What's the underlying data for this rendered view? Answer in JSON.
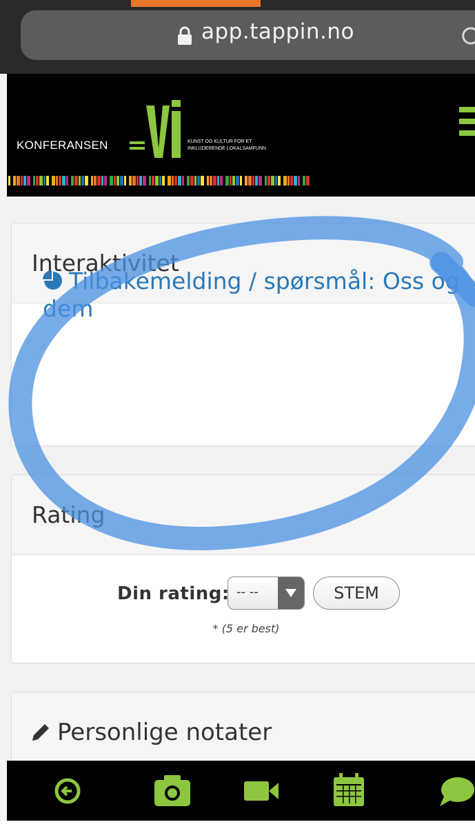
{
  "browser": {
    "url": "app.tappin.no"
  },
  "header": {
    "logo": {
      "left_text": "KONFERANSEN",
      "big_text": "Vi",
      "tagline_line1": "KUNST OG KULTUR FOR ET",
      "tagline_line2": "INKLUDERENDE LOKALSAMFUNN"
    },
    "menu_icon": "hamburger-icon",
    "accent_color": "#8dc63f"
  },
  "sections": {
    "interaktivitet": {
      "title": "Interaktivitet",
      "link_icon": "pie-chart-icon",
      "link_text": "Tilbakemelding / spørsmål: Oss og dem"
    },
    "rating": {
      "title": "Rating",
      "label": "Din rating:",
      "select_value": "-- --",
      "submit_label": "STEM",
      "note": "* (5 er best)"
    },
    "notes": {
      "title": "Personlige notater",
      "icon": "pencil-icon"
    }
  },
  "bottom_nav": {
    "items": [
      {
        "icon": "back-arrow-circle-icon"
      },
      {
        "icon": "camera-icon"
      },
      {
        "icon": "video-camera-icon"
      },
      {
        "icon": "calendar-icon"
      },
      {
        "icon": "chat-bubble-icon"
      }
    ]
  },
  "annotation": {
    "color": "#4a90e2",
    "shape": "hand-drawn-ellipse"
  }
}
